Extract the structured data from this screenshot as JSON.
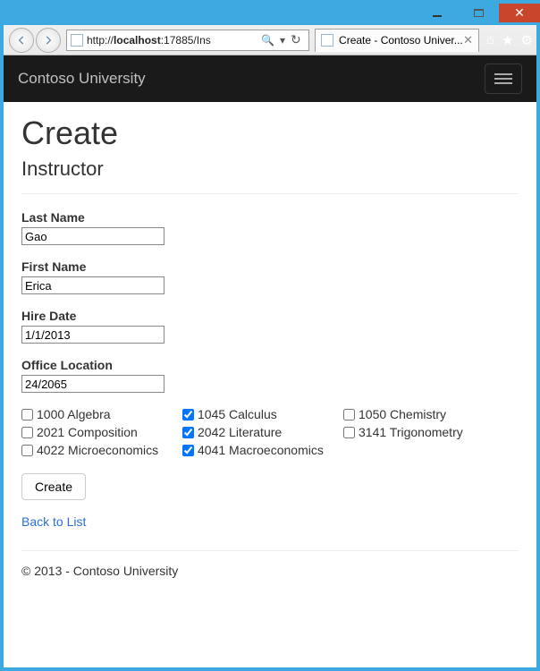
{
  "window": {
    "url_prefix": "http://",
    "url_host": "localhost",
    "url_rest": ":17885/Ins",
    "tab_title": "Create - Contoso Univer..."
  },
  "navbar": {
    "brand": "Contoso University"
  },
  "page": {
    "title": "Create",
    "subtitle": "Instructor"
  },
  "form": {
    "last_name_label": "Last Name",
    "last_name_value": "Gao",
    "first_name_label": "First Name",
    "first_name_value": "Erica",
    "hire_date_label": "Hire Date",
    "hire_date_value": "1/1/2013",
    "office_label": "Office Location",
    "office_value": "24/2065",
    "submit_label": "Create",
    "back_label": "Back to List"
  },
  "courses": [
    [
      {
        "label": "1000 Algebra",
        "checked": false
      },
      {
        "label": "1045 Calculus",
        "checked": true
      },
      {
        "label": "1050 Chemistry",
        "checked": false
      }
    ],
    [
      {
        "label": "2021 Composition",
        "checked": false
      },
      {
        "label": "2042 Literature",
        "checked": true
      },
      {
        "label": "3141 Trigonometry",
        "checked": false
      }
    ],
    [
      {
        "label": "4022 Microeconomics",
        "checked": false
      },
      {
        "label": "4041 Macroeconomics",
        "checked": true
      }
    ]
  ],
  "footer": {
    "text": "© 2013 - Contoso University"
  }
}
